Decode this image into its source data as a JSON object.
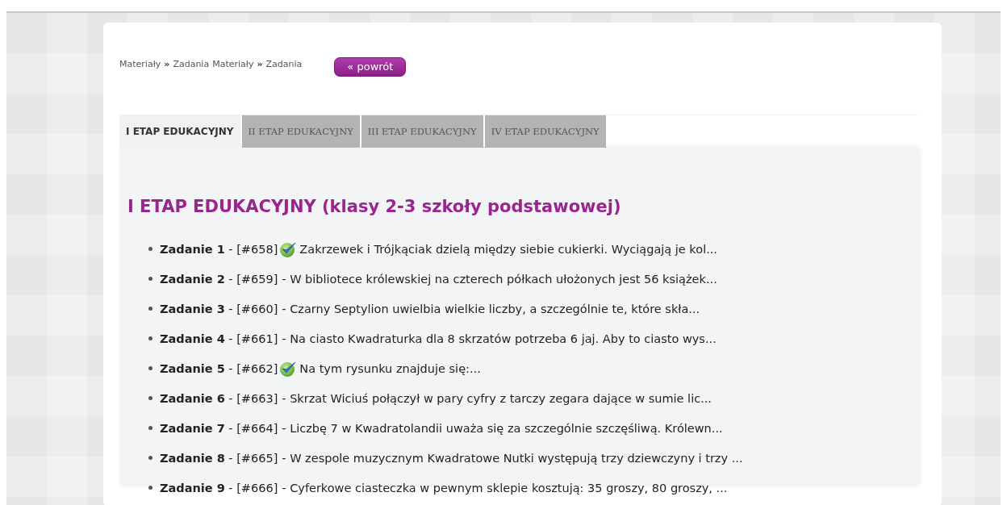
{
  "breadcrumbs": [
    {
      "label": "Materiały",
      "sep": "»"
    },
    {
      "label": "Zadania"
    },
    {
      "label": "Materiały",
      "sep": "»"
    },
    {
      "label": "Zadania"
    }
  ],
  "back_button": "« powrót",
  "tabs": [
    {
      "label": "I ETAP EDUKACYJNY",
      "selected": true
    },
    {
      "label": "II ETAP EDUKACYJNY",
      "selected": false
    },
    {
      "label": "III ETAP EDUKACYJNY",
      "selected": false
    },
    {
      "label": "IV ETAP EDUKACYJNY",
      "selected": false
    }
  ],
  "heading": "I ETAP EDUKACYJNY (klasy 2-3 szkoły podstawowej)",
  "tasks": [
    {
      "head": "**Zadanie 1** - [#658]",
      "solved": true,
      "text": "Zakrzewek i Trójkąciak dzielą między siebie cukierki. Wyciągają je kol..."
    },
    {
      "head": "**Zadanie 2** - [#659]",
      "solved": false,
      "text": "- W bibliotece królewskiej na czterech półkach ułożonych jest 56 książek..."
    },
    {
      "head": "**Zadanie 3** - [#660]",
      "solved": false,
      "text": "- Czarny Septylion uwielbia wielkie liczby, a szczególnie te, które skła..."
    },
    {
      "head": "**Zadanie 4** - [#661]",
      "solved": false,
      "text": "- Na ciasto Kwadraturka dla 8 skrzatów potrzeba 6 jaj. Aby to ciasto wys..."
    },
    {
      "head": "**Zadanie 5** - [#662]",
      "solved": true,
      "text": "Na tym rysunku znajduje się:..."
    },
    {
      "head": "**Zadanie 6** - [#663]",
      "solved": false,
      "text": "- Skrzat Wiciuś połączył w pary cyfry z tarczy zegara dające w sumie lic..."
    },
    {
      "head": "**Zadanie 7** - [#664]",
      "solved": false,
      "text": "- Liczbę 7 w Kwadratolandii uważa się za szczególnie szczęśliwą. Królewn..."
    },
    {
      "head": "**Zadanie 8** - [#665]",
      "solved": false,
      "text": "- W zespole muzycznym Kwadratowe Nutki występują trzy dziewczyny i trzy ..."
    },
    {
      "head": "**Zadanie 9** - [#666]",
      "solved": false,
      "text": "- Cyferkowe ciasteczka w pewnym sklepie kosztują: 35 groszy, 80 groszy, ..."
    }
  ]
}
